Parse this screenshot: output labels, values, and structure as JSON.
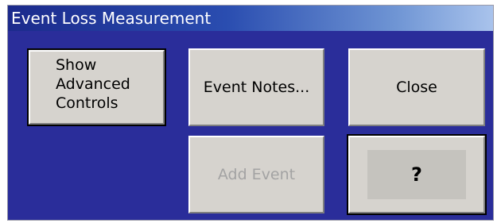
{
  "window": {
    "title": "Event Loss Measurement"
  },
  "buttons": {
    "show_advanced": "Show\nAdvanced\nControls",
    "event_notes": "Event Notes...",
    "close": "Close",
    "add_event": "Add Event",
    "help": "?"
  },
  "colors": {
    "client_background": "#2a2d9a",
    "button_face": "#d6d3ce",
    "disabled_text": "#a3a3a3"
  }
}
